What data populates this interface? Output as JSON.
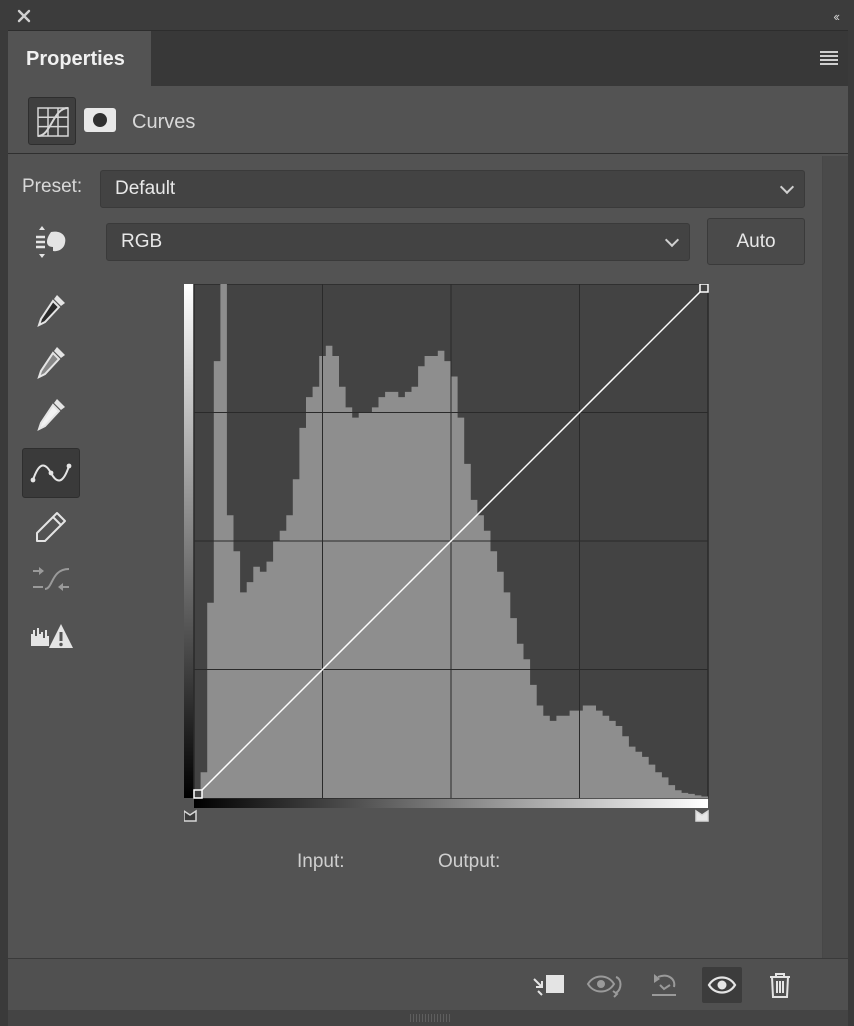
{
  "window": {
    "tab_label": "Properties"
  },
  "header": {
    "title": "Curves"
  },
  "preset": {
    "label": "Preset:",
    "value": "Default"
  },
  "channel": {
    "value": "RGB",
    "auto_label": "Auto"
  },
  "readout": {
    "input_label": "Input:",
    "output_label": "Output:"
  },
  "tools": [
    {
      "name": "on-image-adjust-icon"
    },
    {
      "name": "black-point-eyedropper-icon"
    },
    {
      "name": "gray-point-eyedropper-icon"
    },
    {
      "name": "white-point-eyedropper-icon"
    },
    {
      "name": "curve-points-icon",
      "active": true
    },
    {
      "name": "pencil-icon"
    },
    {
      "name": "smooth-curve-icon"
    },
    {
      "name": "clipping-warning-icon"
    }
  ],
  "curve": {
    "points": [
      [
        0,
        0
      ],
      [
        255,
        255
      ]
    ]
  },
  "histogram_profile": [
    0,
    0.05,
    0.38,
    0.85,
    1.0,
    0.55,
    0.48,
    0.4,
    0.42,
    0.45,
    0.44,
    0.46,
    0.5,
    0.52,
    0.55,
    0.62,
    0.72,
    0.78,
    0.8,
    0.86,
    0.88,
    0.86,
    0.8,
    0.76,
    0.74,
    0.75,
    0.75,
    0.76,
    0.78,
    0.79,
    0.79,
    0.78,
    0.79,
    0.8,
    0.84,
    0.86,
    0.86,
    0.87,
    0.85,
    0.82,
    0.74,
    0.65,
    0.58,
    0.55,
    0.52,
    0.48,
    0.44,
    0.4,
    0.35,
    0.3,
    0.27,
    0.22,
    0.18,
    0.16,
    0.15,
    0.16,
    0.16,
    0.17,
    0.17,
    0.18,
    0.18,
    0.17,
    0.16,
    0.15,
    0.14,
    0.12,
    0.1,
    0.09,
    0.08,
    0.065,
    0.05,
    0.04,
    0.025,
    0.015,
    0.01,
    0.008,
    0.005,
    0.003
  ],
  "footer": {
    "buttons": [
      {
        "name": "clip-to-layer-icon"
      },
      {
        "name": "view-previous-state-icon"
      },
      {
        "name": "reset-icon"
      },
      {
        "name": "visibility-eye-icon",
        "active": true
      },
      {
        "name": "trash-icon"
      }
    ]
  },
  "colors": {
    "panel_bg": "#535353",
    "graph_bg": "#434343",
    "histogram": "#8e8e8e",
    "curve_line": "#ffffff"
  }
}
